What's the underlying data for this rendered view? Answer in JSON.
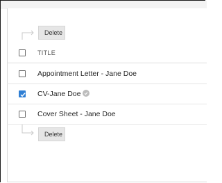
{
  "toolbar_top": {
    "delete_label": "Delete"
  },
  "table": {
    "header": {
      "title": "TITLE"
    },
    "rows": [
      {
        "title": "Appointment Letter - Jane Doe",
        "checked": false
      },
      {
        "title": "CV-Jane Doe",
        "checked": true
      },
      {
        "title": "Cover Sheet - Jane Doe",
        "checked": false
      }
    ]
  },
  "toolbar_bottom": {
    "delete_label": "Delete"
  }
}
